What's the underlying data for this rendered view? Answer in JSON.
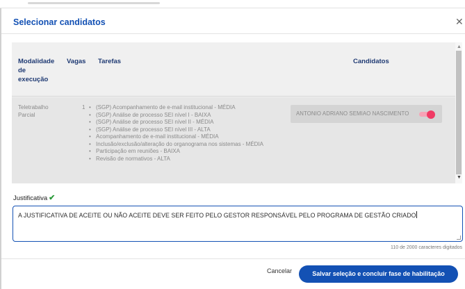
{
  "modal": {
    "title": "Selecionar candidatos",
    "close_icon": "close-icon"
  },
  "table": {
    "headers": {
      "modalidade": [
        "Modalidade",
        "de",
        "execução"
      ],
      "vagas": "Vagas",
      "tarefas": "Tarefas",
      "candidatos": "Candidatos"
    },
    "rows": [
      {
        "modalidade": [
          "Teletrabalho",
          "Parcial"
        ],
        "vagas": "1",
        "tarefas": [
          "(SGP) Acompanhamento de e-mail institucional - MÉDIA",
          "(SGP) Análise de processo SEI nível I - BAIXA",
          "(SGP) Análise de processo SEI nível II - MÉDIA",
          "(SGP) Análise de processo SEI nível III - ALTA",
          "Acompanhamento de e-mail institucional - MÉDIA",
          "Inclusão/exclusão/alteração do organograma nos sistemas - MÉDIA",
          "Participação em reuniões - BAIXA",
          "Revisão de normativos - ALTA"
        ],
        "candidato": {
          "name": "ANTONIO ADRIANO SEMIAO NASCIMENTO",
          "selected": true
        }
      }
    ]
  },
  "justificativa": {
    "label": "Justificativa",
    "check_icon": "✔",
    "value": "A JUSTIFICATIVA DE ACEITE OU NÃO ACEITE DEVE SER FEITO PELO GESTOR RESPONSÁVEL PELO PROGRAMA DE GESTÃO CRIADO",
    "counter": "110 de 2000 caracteres digitados"
  },
  "footer": {
    "cancel_label": "Cancelar",
    "primary_label": "Salvar seleção e concluir fase de habilitação"
  },
  "colors": {
    "accent": "#1351b4",
    "toggle_on": "#f03a64",
    "check": "#2a9a3a"
  }
}
